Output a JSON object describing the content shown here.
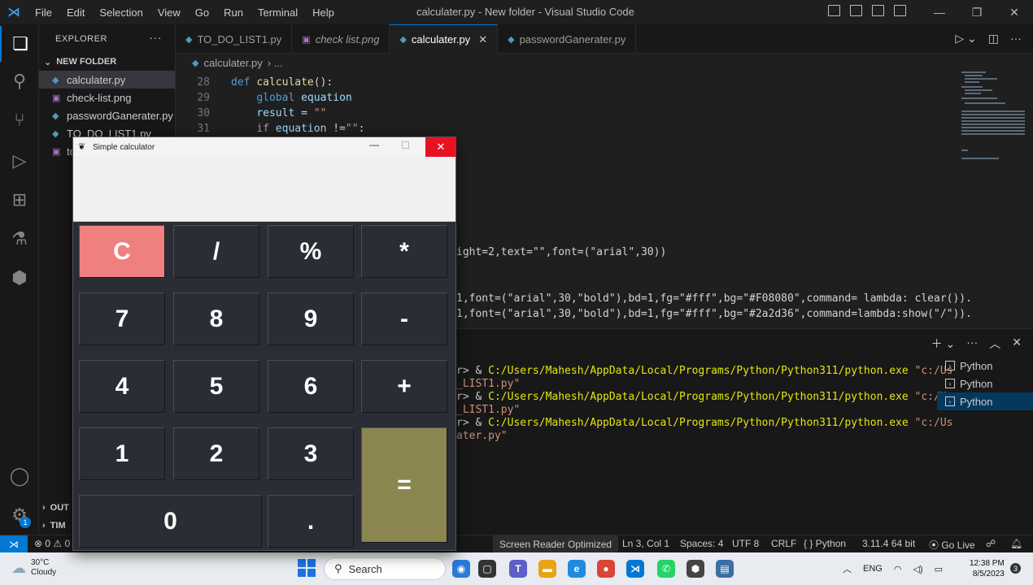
{
  "window": {
    "menu": [
      "File",
      "Edit",
      "Selection",
      "View",
      "Go",
      "Run",
      "Terminal",
      "Help"
    ],
    "title": "calculater.py - New folder - Visual Studio Code"
  },
  "sidebar": {
    "header": "EXPLORER",
    "folder": "NEW FOLDER",
    "files": [
      {
        "name": "calculater.py",
        "selected": true
      },
      {
        "name": "check-list.png",
        "selected": false
      },
      {
        "name": "passwordGanerater.py",
        "selected": false
      },
      {
        "name": "TO_DO_LIST1.py",
        "selected": false
      },
      {
        "name": "to",
        "selected": false
      }
    ],
    "outline": "OUT",
    "timeline": "TIM"
  },
  "tabs": [
    {
      "label": "TO_DO_LIST1.py",
      "active": false
    },
    {
      "label": "check list.png",
      "active": false
    },
    {
      "label": "calculater.py",
      "active": true
    },
    {
      "label": "passwordGanerater.py",
      "active": false
    }
  ],
  "breadcrumb": {
    "file": "calculater.py",
    "rest": "›  ..."
  },
  "code": {
    "lines": [
      {
        "n": "28",
        "tokens": [
          [
            "kw",
            "def "
          ],
          [
            "fn",
            "calculate"
          ],
          [
            "pl",
            "():"
          ]
        ]
      },
      {
        "n": "29",
        "tokens": [
          [
            "pl",
            "    "
          ],
          [
            "kw",
            "global"
          ],
          [
            "pl",
            " "
          ],
          [
            "vr",
            "equation"
          ]
        ]
      },
      {
        "n": "30",
        "tokens": [
          [
            "pl",
            "    "
          ],
          [
            "vr",
            "result"
          ],
          [
            "pl",
            " = "
          ],
          [
            "st",
            "\"\""
          ]
        ]
      },
      {
        "n": "31",
        "tokens": [
          [
            "pl",
            "    "
          ],
          [
            "pk",
            "if"
          ],
          [
            "pl",
            " "
          ],
          [
            "vr",
            "equation"
          ],
          [
            "pl",
            " !="
          ],
          [
            "st",
            "\"\""
          ],
          [
            "pl",
            ":"
          ]
        ]
      }
    ],
    "fragment_1": "ight=2,text=\"\",font=(\"arial\",30))",
    "fragment_2": "1,font=(\"arial\",30,\"bold\"),bd=1,fg=\"#fff\",bg=\"#F08080\",command= lambda: clear()).",
    "fragment_3": "1,font=(\"arial\",30,\"bold\"),bd=1,fg=\"#fff\",bg=\"#2a2d36\",command=lambda:show(\"/\"))."
  },
  "terminal": {
    "lines": [
      {
        "a": "r> & ",
        "b": "C:/Users/Mahesh/AppData/Local/Programs/Python/Python311/python.exe",
        "c": " \"c:/Us"
      },
      {
        "a": "",
        "b": "",
        "c": "_LIST1.py\""
      },
      {
        "a": "r> & ",
        "b": "C:/Users/Mahesh/AppData/Local/Programs/Python/Python311/python.exe",
        "c": " \"c:/Us"
      },
      {
        "a": "",
        "b": "",
        "c": "_LIST1.py\""
      },
      {
        "a": "r> & ",
        "b": "C:/Users/Mahesh/AppData/Local/Programs/Python/Python311/python.exe",
        "c": " \"c:/Us"
      },
      {
        "a": "",
        "b": "",
        "c": "ater.py\""
      }
    ],
    "instances": [
      "Python",
      "Python",
      "Python"
    ]
  },
  "statusbar": {
    "errors": "⊗ 0 ⚠ 0",
    "reader": "Screen Reader Optimized",
    "position": "Ln 3, Col 1",
    "spaces": "Spaces: 4",
    "encoding": "UTF 8",
    "eol": "CRLF",
    "language": "{ }  Python",
    "version": "3.11.4 64 bit",
    "golive": "⦿ Go Live"
  },
  "taskbar": {
    "temp": "30°C",
    "condition": "Cloudy",
    "search": "Search",
    "lang": "ENG",
    "time": "12:38 PM",
    "date": "8/5/2023",
    "notif": "3"
  },
  "calculator": {
    "title": "Simple calculator",
    "display": "",
    "buttons": {
      "clear": "C",
      "div": "/",
      "mod": "%",
      "mul": "*",
      "seven": "7",
      "eight": "8",
      "nine": "9",
      "minus": "-",
      "four": "4",
      "five": "5",
      "six": "6",
      "plus": "+",
      "one": "1",
      "two": "2",
      "three": "3",
      "equals": "=",
      "zero": "0",
      "dot": "."
    },
    "colors": {
      "clear": "#F08080",
      "button": "#2a2d36",
      "equals": "#8b8650",
      "text": "#ffffff"
    }
  }
}
